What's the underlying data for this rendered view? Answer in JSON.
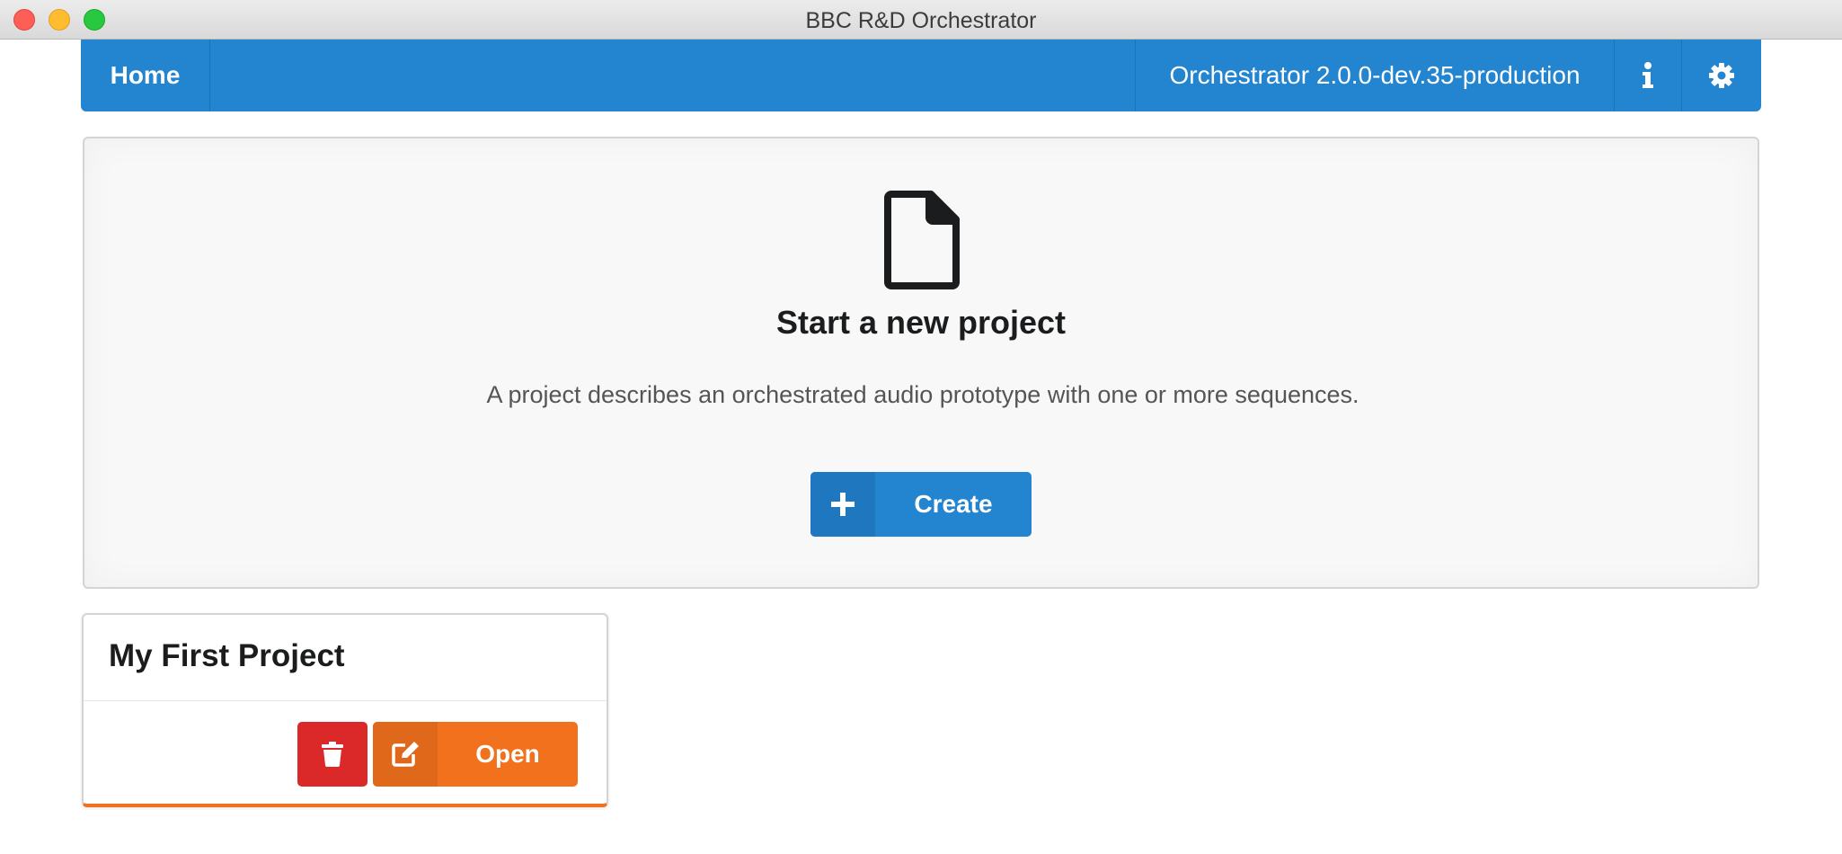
{
  "window": {
    "title": "BBC R&D Orchestrator"
  },
  "navbar": {
    "home_label": "Home",
    "version_label": "Orchestrator 2.0.0-dev.35-production",
    "info_icon": "info-icon",
    "settings_icon": "gear-icon",
    "color": "#2384d0"
  },
  "hero": {
    "icon": "file-icon",
    "title": "Start a new project",
    "description": "A project describes an orchestrated audio prototype with one or more sequences.",
    "create_button": {
      "icon": "plus-icon",
      "label": "Create"
    }
  },
  "projects": [
    {
      "name": "My First Project",
      "delete_icon": "trash-icon",
      "open_button": {
        "icon": "edit-icon",
        "label": "Open"
      }
    }
  ],
  "colors": {
    "primary": "#2384d0",
    "danger": "#db2828",
    "accent": "#f2711c"
  }
}
